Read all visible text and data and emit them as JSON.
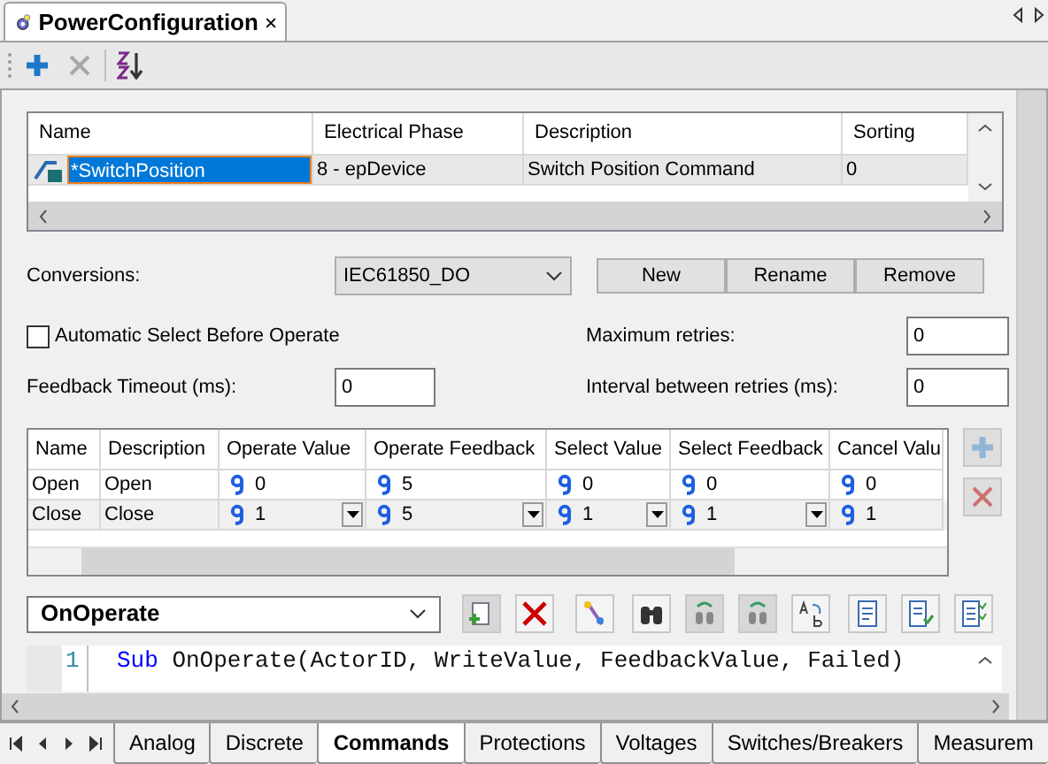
{
  "document_tab": {
    "title": "PowerConfiguration",
    "selected": true
  },
  "toolbar": [
    {
      "kind": "add",
      "disabled": false
    },
    {
      "kind": "delete",
      "disabled": true
    },
    {
      "kind": "sort",
      "disabled": false
    }
  ],
  "commands_table": {
    "columns": [
      "Name",
      "Electrical Phase",
      "Description",
      "Sorting"
    ],
    "rows": [
      {
        "cells": [
          "*SwitchPosition",
          "8 - epDevice",
          "Switch Position Command",
          "0"
        ],
        "selected": true
      }
    ]
  },
  "conversions": {
    "label": "Conversions:",
    "value": "IEC61850_DO",
    "buttons": [
      "New",
      "Rename",
      "Remove"
    ]
  },
  "auto_select": {
    "label": "Automatic Select Before Operate",
    "checked": false
  },
  "feedback_timeout": {
    "label": "Feedback Timeout (ms):",
    "value": "0"
  },
  "max_retries": {
    "label": "Maximum retries:",
    "value": "0"
  },
  "retry_interval": {
    "label": "Interval between retries (ms):",
    "value": "0"
  },
  "values_table": {
    "columns": [
      "Name",
      "Description",
      "Operate Value",
      "Operate Feedback",
      "Select Value",
      "Select Feedback",
      "Cancel Valu"
    ],
    "rows": [
      {
        "name": "Open",
        "description": "Open",
        "values": [
          "0",
          "5",
          "0",
          "0",
          "0"
        ],
        "selected": false
      },
      {
        "name": "Close",
        "description": "Close",
        "values": [
          "1",
          "5",
          "1",
          "1",
          "1"
        ],
        "selected": true
      }
    ]
  },
  "side_buttons": [
    {
      "kind": "add",
      "disabled": true
    },
    {
      "kind": "delete",
      "disabled": true
    }
  ],
  "script_event": {
    "value": "OnOperate"
  },
  "script_tools": [
    {
      "kind": "new",
      "disabled": true
    },
    {
      "kind": "delete",
      "disabled": false
    },
    {
      "kind": "wand",
      "disabled": false
    },
    {
      "kind": "find",
      "disabled": false
    },
    {
      "kind": "find-prev",
      "disabled": true
    },
    {
      "kind": "find-next",
      "disabled": true
    },
    {
      "kind": "replace",
      "disabled": false
    },
    {
      "kind": "doc",
      "disabled": false
    },
    {
      "kind": "doc-check",
      "disabled": false
    },
    {
      "kind": "doc-list",
      "disabled": false
    }
  ],
  "code": [
    {
      "number": "1",
      "tokens": [
        {
          "kind": "keyword",
          "text": "Sub"
        },
        {
          "kind": "plain",
          "text": " OnOperate(ActorID, WriteValue, FeedbackValue, Failed)"
        }
      ]
    }
  ],
  "sheet_tabs": [
    {
      "label": "Analog",
      "selected": false
    },
    {
      "label": "Discrete",
      "selected": false
    },
    {
      "label": "Commands",
      "selected": true
    },
    {
      "label": "Protections",
      "selected": false
    },
    {
      "label": "Voltages",
      "selected": false
    },
    {
      "label": "Switches/Breakers",
      "selected": false
    },
    {
      "label": "Measurem",
      "selected": false
    }
  ]
}
